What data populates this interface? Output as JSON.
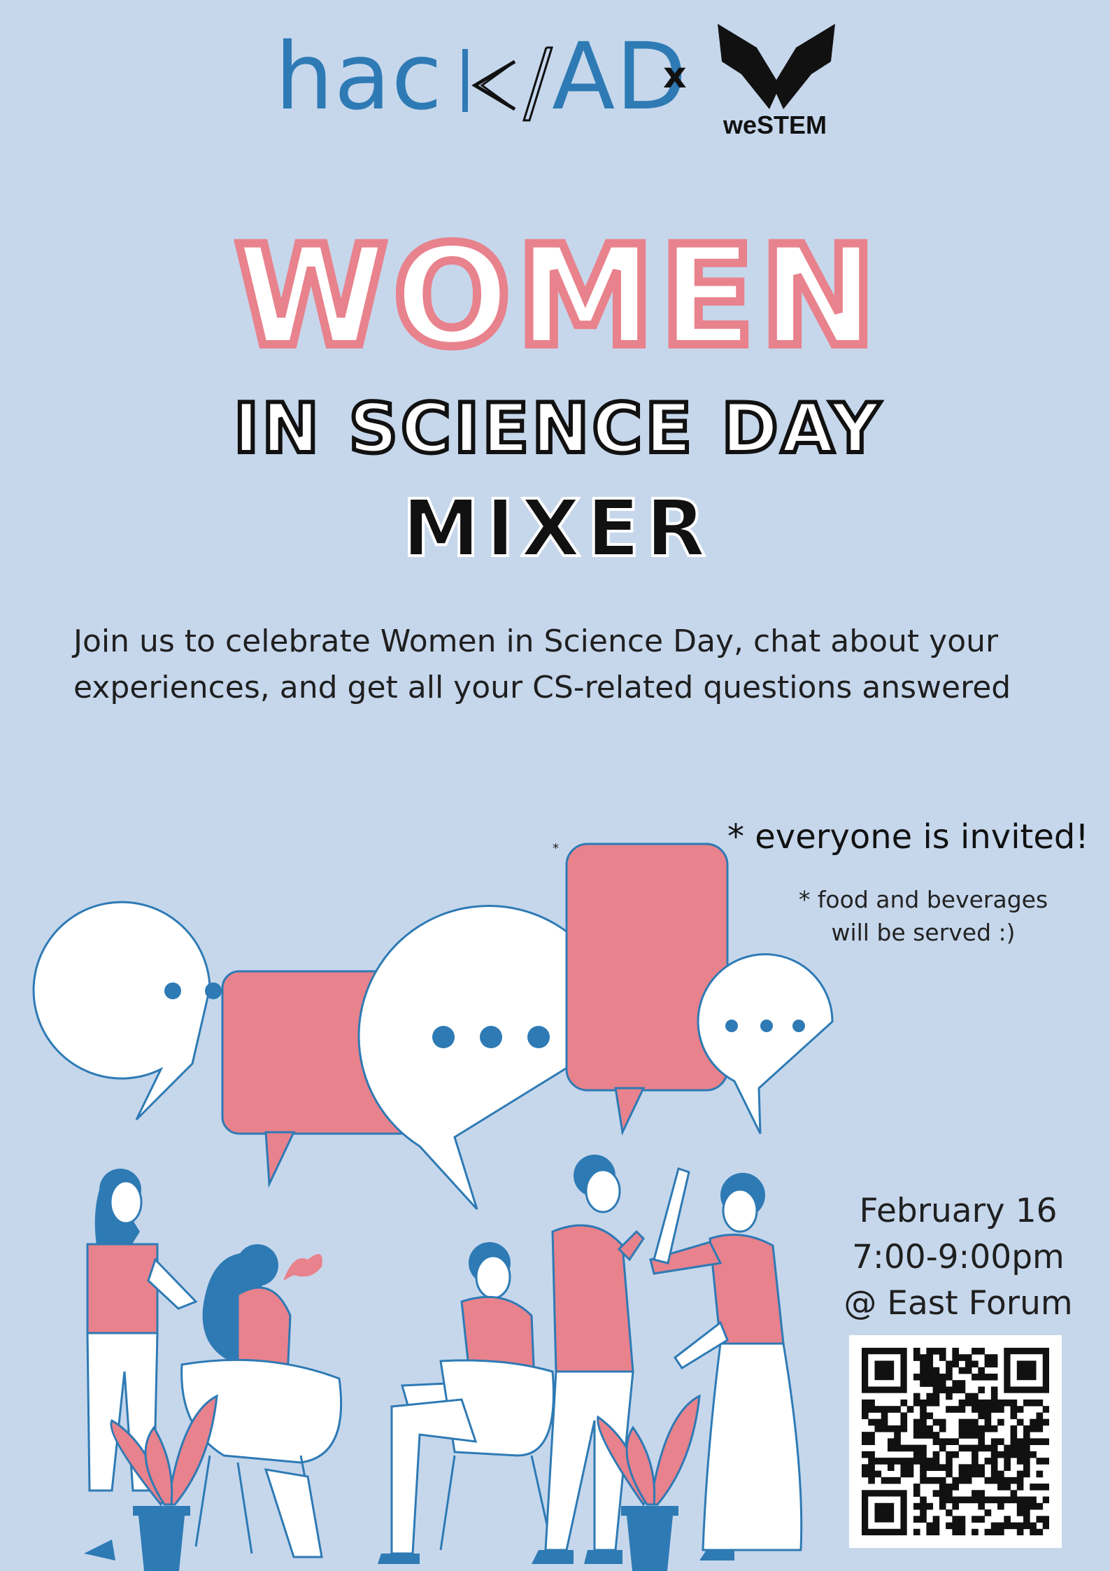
{
  "header": {
    "logo_left_text_a": "hac",
    "logo_left_text_b": "AD",
    "connector": "x",
    "logo_right_text": "weSTEM"
  },
  "title": {
    "line1": "WOMEN",
    "line2": "IN SCIENCE DAY",
    "line3": "MIXER"
  },
  "intro": "Join us to celebrate Women in Science Day, chat about your experiences, and get all your CS-related questions answered",
  "notes": {
    "invited": "* everyone is invited!",
    "food": "* food  and beverages will be served  :)"
  },
  "event": {
    "date": "February 16",
    "time": "7:00-9:00pm",
    "location": "@ East Forum"
  },
  "colors": {
    "background": "#c6d7ec",
    "pink": "#e8828c",
    "blue": "#2e7ab4",
    "white": "#ffffff",
    "black": "#111111"
  },
  "icons": {
    "speech_bubble": "speech-bubble-icon",
    "qr": "qr-code-icon",
    "westem": "butterfly-logo-icon"
  }
}
